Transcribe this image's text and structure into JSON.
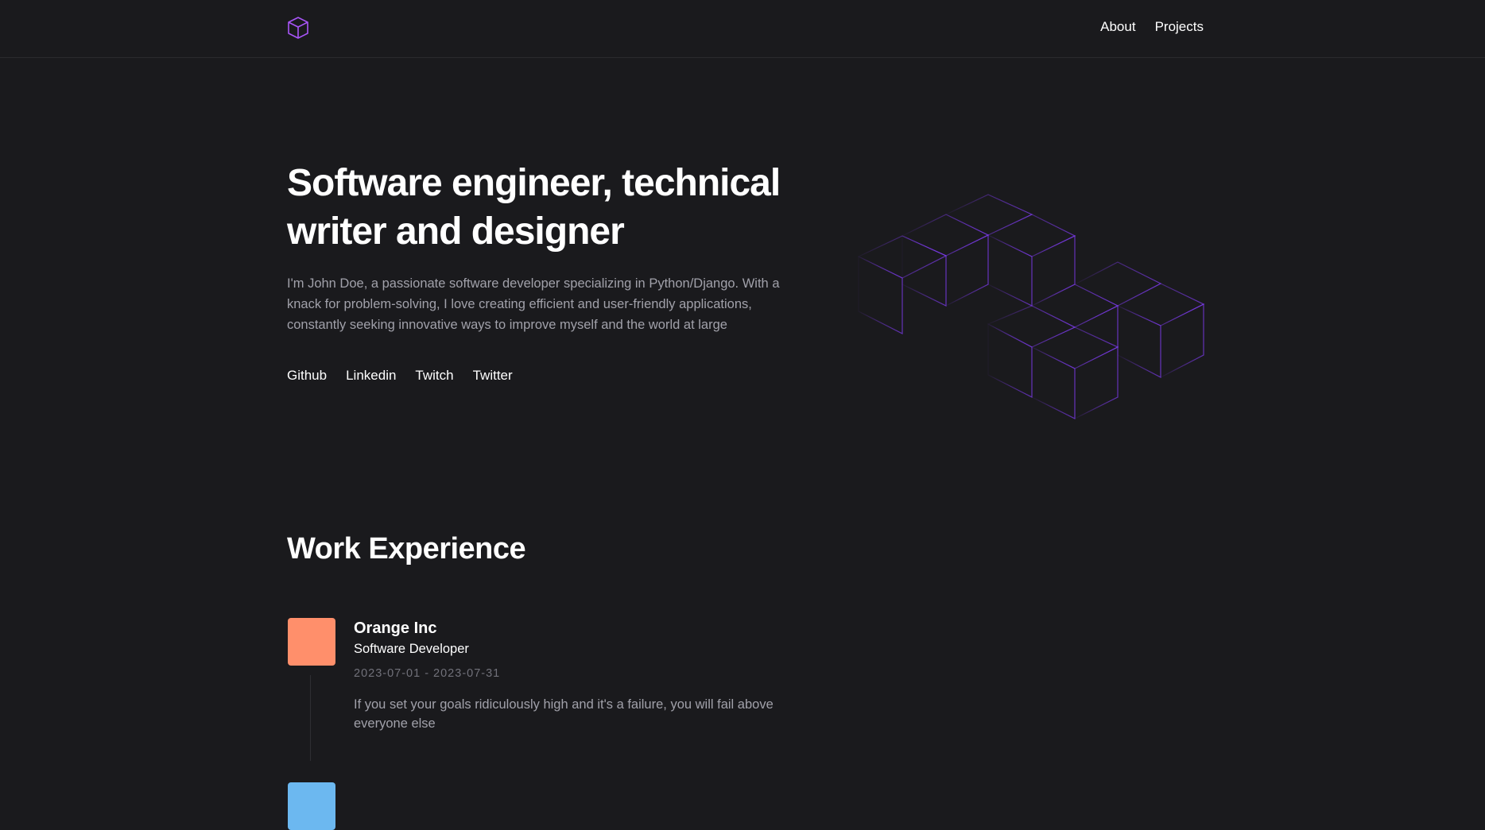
{
  "header": {
    "nav": [
      {
        "label": "About"
      },
      {
        "label": "Projects"
      }
    ]
  },
  "hero": {
    "title": "Software engineer, technical writer and designer",
    "description": "I'm John Doe, a passionate software developer specializing in Python/Django. With a knack for problem-solving, I love creating efficient and user-friendly applications, constantly seeking innovative ways to improve myself and the world at large",
    "socials": [
      {
        "label": "Github"
      },
      {
        "label": "Linkedin"
      },
      {
        "label": "Twitch"
      },
      {
        "label": "Twitter"
      }
    ]
  },
  "work": {
    "title": "Work Experience",
    "items": [
      {
        "company": "Orange Inc",
        "role": "Software Developer",
        "dates": "2023-07-01 - 2023-07-31",
        "description": "If you set your goals ridiculously high and it's a failure, you will fail above everyone else",
        "logo_color": "#ff8f6b"
      }
    ],
    "next_logo_color": "#6cb8f0"
  },
  "colors": {
    "background": "#1a1a1d",
    "accent": "#a855f7",
    "muted_text": "#a1a1aa"
  },
  "icons": {
    "logo": "cube-icon",
    "illustration": "isometric-cubes"
  }
}
